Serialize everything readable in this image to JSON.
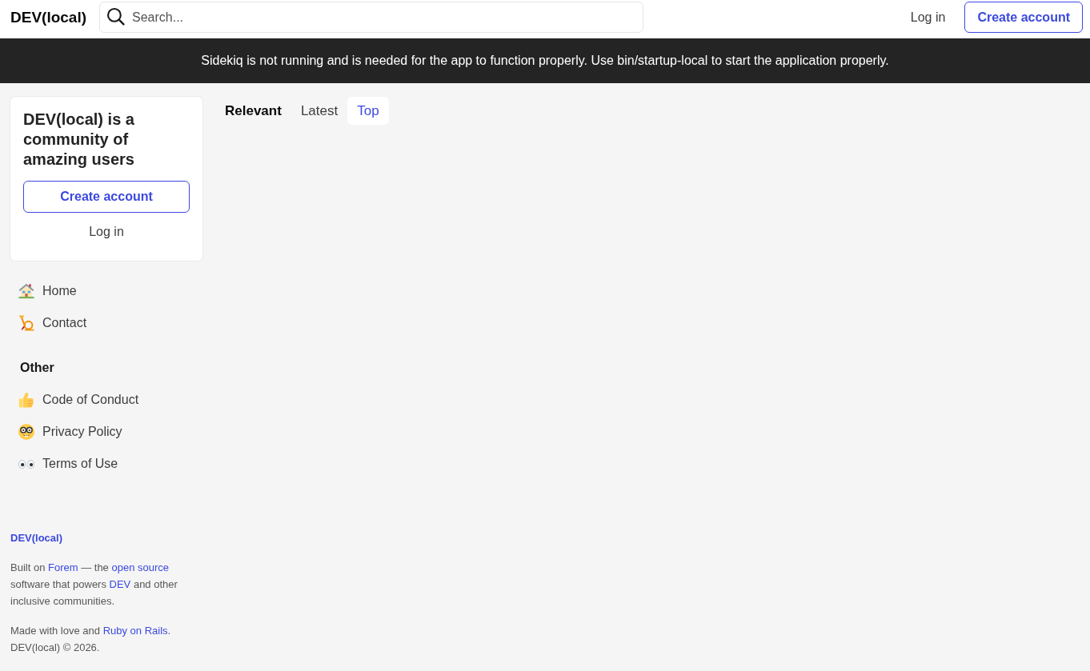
{
  "header": {
    "logo": "DEV(local)",
    "search": {
      "placeholder": "Search..."
    },
    "actions": [
      {
        "label": "Log in",
        "kind": "link"
      },
      {
        "label": "Create account",
        "kind": "outline"
      }
    ]
  },
  "banner": {
    "text": "Sidekiq is not running and is needed for the app to function properly. Use bin/startup-local to start the application properly."
  },
  "sidebar": {
    "card": {
      "heading": "DEV(local) is a community of amazing users",
      "actions": [
        {
          "label": "Create account",
          "kind": "outline"
        },
        {
          "label": "Log in",
          "kind": "link"
        }
      ]
    },
    "nav": [
      {
        "label": "Home"
      },
      {
        "label": "Contact"
      }
    ],
    "sections": [
      {
        "title": "Other",
        "items": [
          {
            "label": "Code of Conduct"
          },
          {
            "label": "Privacy Policy"
          },
          {
            "label": "Terms of Use"
          }
        ]
      }
    ],
    "footer": {
      "title": "DEV(local)",
      "paragraphs": [
        [
          {
            "kind": "text",
            "text": "Built on "
          },
          {
            "kind": "link",
            "text": "Forem"
          },
          {
            "kind": "text",
            "text": " — the "
          },
          {
            "kind": "link",
            "text": "open source"
          },
          {
            "kind": "text",
            "text": " software that powers "
          },
          {
            "kind": "link",
            "text": "DEV"
          },
          {
            "kind": "text",
            "text": " and other inclusive communities."
          }
        ],
        [
          {
            "kind": "text",
            "text": "Made with love and "
          },
          {
            "kind": "link",
            "text": "Ruby on Rails"
          },
          {
            "kind": "text",
            "text": ". DEV(local) © 2026."
          }
        ]
      ]
    }
  },
  "feed": {
    "tabs": [
      {
        "label": "Relevant",
        "selected": true,
        "hovered": false
      },
      {
        "label": "Latest",
        "selected": false,
        "hovered": false
      },
      {
        "label": "Top",
        "selected": false,
        "hovered": true
      }
    ]
  }
}
